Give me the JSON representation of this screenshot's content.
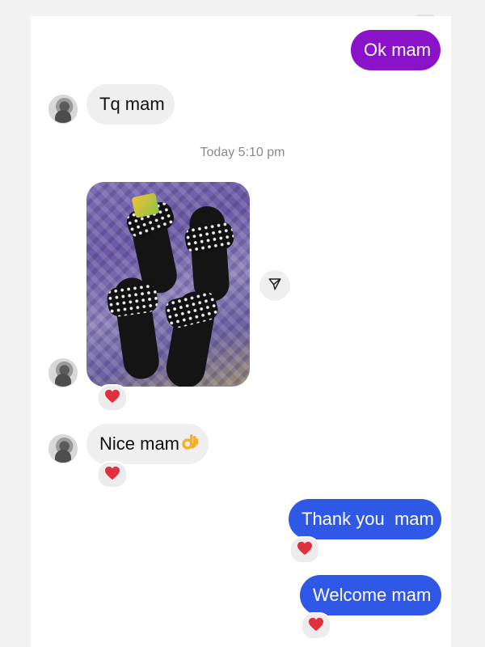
{
  "messages": {
    "ok_mam": "Ok mam",
    "tq_mam": "Tq mam",
    "timestamp": "Today 5:10 pm",
    "nice_mam": "Nice mam",
    "thank_you": "Thank you  mam",
    "welcome": "Welcome mam"
  },
  "colors": {
    "purple_bubble": "#8a13c9",
    "blue_bubble": "#2f58e6",
    "incoming_bubble": "#efefef",
    "heart": "#e0303d"
  },
  "icons": {
    "share": "send-icon",
    "reaction": "heart-icon",
    "ok_hand": "ok-hand-emoji"
  }
}
